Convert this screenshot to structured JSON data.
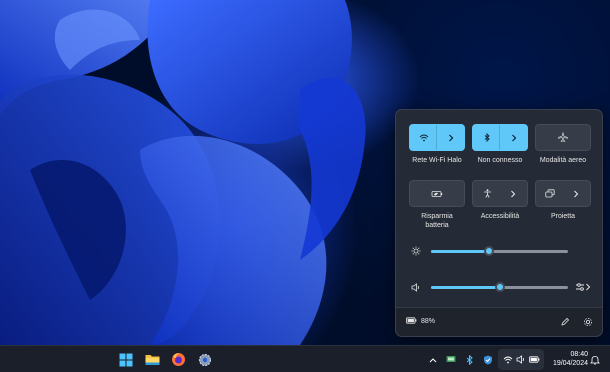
{
  "quick_settings": {
    "tiles_row1": [
      {
        "label": "Rete Wi-Fi Halo",
        "icon": "wifi-icon",
        "active": true,
        "expandable": true
      },
      {
        "label": "Non connesso",
        "icon": "bluetooth-icon",
        "active": true,
        "expandable": true
      },
      {
        "label": "Modalità aereo",
        "icon": "airplane-icon",
        "active": false,
        "expandable": false
      }
    ],
    "tiles_row2": [
      {
        "label": "Risparmia batteria",
        "icon": "battery-saver-icon",
        "active": false,
        "expandable": false
      },
      {
        "label": "Accessibilità",
        "icon": "accessibility-icon",
        "active": false,
        "expandable": true
      },
      {
        "label": "Proietta",
        "icon": "cast-icon",
        "active": false,
        "expandable": true
      }
    ],
    "brightness": {
      "icon": "brightness-icon",
      "level": 0.42
    },
    "volume": {
      "icon": "speaker-icon",
      "level": 0.5,
      "extra_icon": "audio-output-icon"
    },
    "footer": {
      "battery_text": "88%",
      "battery_icon": "battery-icon",
      "edit_icon": "pencil-icon",
      "settings_icon": "gear-icon"
    }
  },
  "taskbar": {
    "apps": [
      "start-icon",
      "file-explorer-icon",
      "firefox-icon",
      "settings-app-icon"
    ],
    "tray": [
      "chevron-up-icon",
      "network-tray-icon",
      "bluetooth-tray-icon",
      "security-icon",
      "wifi-icon",
      "volume-icon",
      "battery-icon",
      "notification-bell-icon"
    ],
    "clock": {
      "time": "08:40",
      "date": "19/04/2024"
    }
  },
  "colors": {
    "accent": "#60c8f8",
    "panel": "#252b36",
    "taskbar": "#1a1f2a"
  }
}
